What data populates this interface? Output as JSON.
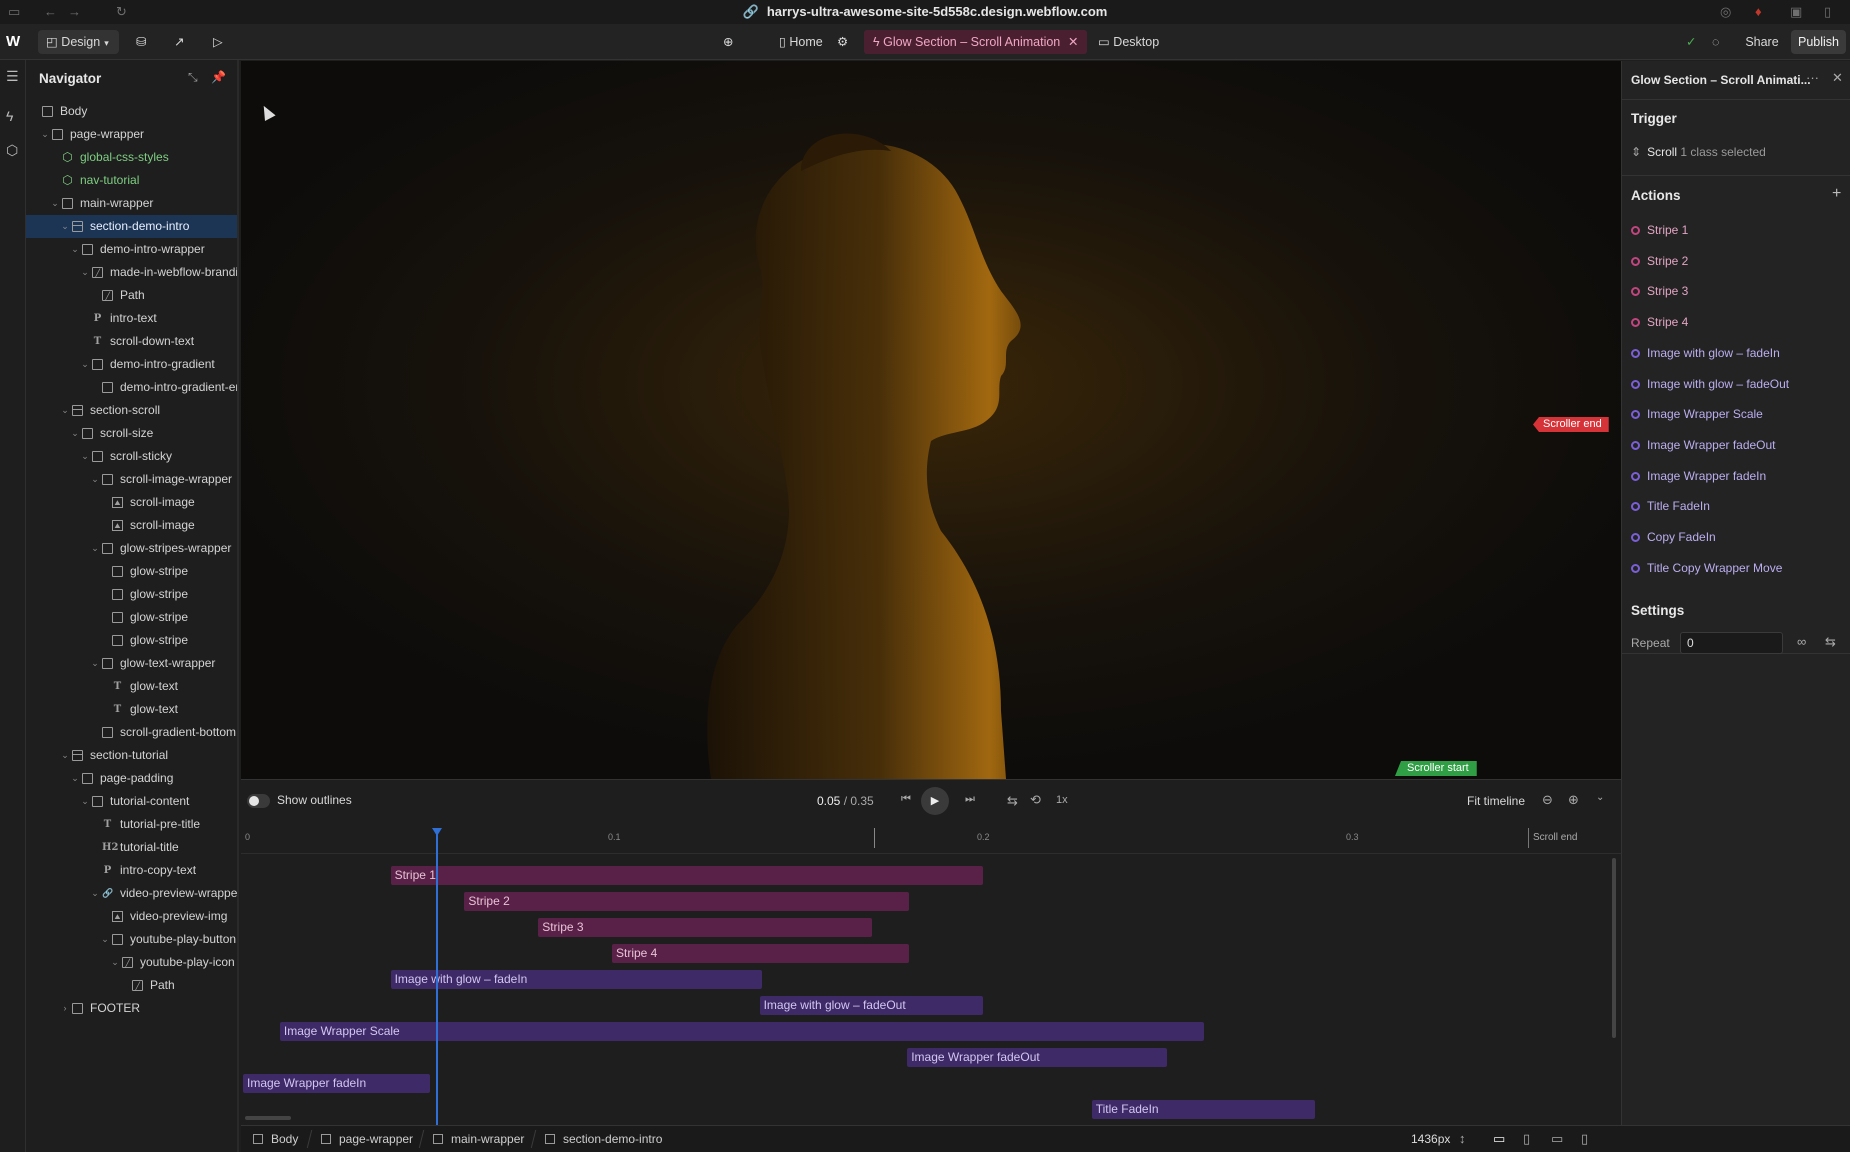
{
  "browser": {
    "url": "harrys-ultra-awesome-site-5d558c.design.webflow.com"
  },
  "toolbar": {
    "mode_label": "Design",
    "page_name": "Home",
    "interaction_name": "Glow Section – Scroll Animation",
    "breakpoint_label": "Desktop",
    "share_label": "Share",
    "publish_label": "Publish"
  },
  "navigator": {
    "title": "Navigator",
    "items": [
      {
        "label": "Body",
        "depth": 0,
        "icon": "box",
        "caret": false
      },
      {
        "label": "page-wrapper",
        "depth": 1,
        "icon": "box",
        "caret": true
      },
      {
        "label": "global-css-styles",
        "depth": 2,
        "icon": "comp",
        "caret": false,
        "green": true
      },
      {
        "label": "nav-tutorial",
        "depth": 2,
        "icon": "comp",
        "caret": false,
        "green": true
      },
      {
        "label": "main-wrapper",
        "depth": 2,
        "icon": "box",
        "caret": true
      },
      {
        "label": "section-demo-intro",
        "depth": 3,
        "icon": "section",
        "caret": true,
        "selected": true
      },
      {
        "label": "demo-intro-wrapper",
        "depth": 4,
        "icon": "box",
        "caret": true
      },
      {
        "label": "made-in-webflow-branding",
        "depth": 5,
        "icon": "svg",
        "caret": true
      },
      {
        "label": "Path",
        "depth": 6,
        "icon": "svg",
        "caret": false
      },
      {
        "label": "intro-text",
        "depth": 5,
        "icon": "P",
        "caret": false
      },
      {
        "label": "scroll-down-text",
        "depth": 5,
        "icon": "T",
        "caret": false
      },
      {
        "label": "demo-intro-gradient",
        "depth": 5,
        "icon": "box",
        "caret": true
      },
      {
        "label": "demo-intro-gradient-end",
        "depth": 6,
        "icon": "box",
        "caret": false
      },
      {
        "label": "section-scroll",
        "depth": 3,
        "icon": "section",
        "caret": true
      },
      {
        "label": "scroll-size",
        "depth": 4,
        "icon": "box",
        "caret": true
      },
      {
        "label": "scroll-sticky",
        "depth": 5,
        "icon": "box",
        "caret": true
      },
      {
        "label": "scroll-image-wrapper",
        "depth": 6,
        "icon": "box",
        "caret": true
      },
      {
        "label": "scroll-image",
        "depth": 7,
        "icon": "img",
        "caret": false
      },
      {
        "label": "scroll-image",
        "depth": 7,
        "icon": "img",
        "caret": false
      },
      {
        "label": "glow-stripes-wrapper",
        "depth": 6,
        "icon": "box",
        "caret": true
      },
      {
        "label": "glow-stripe",
        "depth": 7,
        "icon": "box",
        "caret": false
      },
      {
        "label": "glow-stripe",
        "depth": 7,
        "icon": "box",
        "caret": false
      },
      {
        "label": "glow-stripe",
        "depth": 7,
        "icon": "box",
        "caret": false
      },
      {
        "label": "glow-stripe",
        "depth": 7,
        "icon": "box",
        "caret": false
      },
      {
        "label": "glow-text-wrapper",
        "depth": 6,
        "icon": "box",
        "caret": true
      },
      {
        "label": "glow-text",
        "depth": 7,
        "icon": "T",
        "caret": false
      },
      {
        "label": "glow-text",
        "depth": 7,
        "icon": "T",
        "caret": false
      },
      {
        "label": "scroll-gradient-bottom",
        "depth": 6,
        "icon": "box",
        "caret": false
      },
      {
        "label": "section-tutorial",
        "depth": 3,
        "icon": "section",
        "caret": true
      },
      {
        "label": "page-padding",
        "depth": 4,
        "icon": "box",
        "caret": true
      },
      {
        "label": "tutorial-content",
        "depth": 5,
        "icon": "box",
        "caret": true
      },
      {
        "label": "tutorial-pre-title",
        "depth": 6,
        "icon": "T",
        "caret": false
      },
      {
        "label": "tutorial-title",
        "depth": 6,
        "icon": "H2",
        "caret": false
      },
      {
        "label": "intro-copy-text",
        "depth": 6,
        "icon": "P",
        "caret": false
      },
      {
        "label": "video-preview-wrapper",
        "depth": 6,
        "icon": "link",
        "caret": true
      },
      {
        "label": "video-preview-img",
        "depth": 7,
        "icon": "img",
        "caret": false
      },
      {
        "label": "youtube-play-button",
        "depth": 7,
        "icon": "box",
        "caret": true
      },
      {
        "label": "youtube-play-icon",
        "depth": 8,
        "icon": "svg",
        "caret": true
      },
      {
        "label": "Path",
        "depth": 9,
        "icon": "svg",
        "caret": false
      },
      {
        "label": "FOOTER",
        "depth": 3,
        "icon": "box",
        "caret": "closed"
      }
    ]
  },
  "canvas": {
    "scroller_end_label": "Scroller end",
    "scroller_start_label": "Scroller start"
  },
  "inspector": {
    "title": "Glow Section – Scroll Animati...",
    "trigger_heading": "Trigger",
    "trigger_type": "Scroll",
    "trigger_detail": "1 class selected",
    "actions_heading": "Actions",
    "actions": [
      {
        "label": "Stripe 1",
        "color": "#c2457f"
      },
      {
        "label": "Stripe 2",
        "color": "#c2457f"
      },
      {
        "label": "Stripe 3",
        "color": "#c2457f"
      },
      {
        "label": "Stripe 4",
        "color": "#c2457f"
      },
      {
        "label": "Image with glow – fadeIn",
        "color": "#7b5fd6"
      },
      {
        "label": "Image with glow – fadeOut",
        "color": "#7b5fd6"
      },
      {
        "label": "Image Wrapper Scale",
        "color": "#7b5fd6"
      },
      {
        "label": "Image Wrapper fadeOut",
        "color": "#7b5fd6"
      },
      {
        "label": "Image Wrapper fadeIn",
        "color": "#7b5fd6"
      },
      {
        "label": "Title FadeIn",
        "color": "#7b5fd6"
      },
      {
        "label": "Copy FadeIn",
        "color": "#7b5fd6"
      },
      {
        "label": "Title Copy Wrapper Move",
        "color": "#7b5fd6"
      }
    ],
    "settings_heading": "Settings",
    "repeat_label": "Repeat",
    "repeat_value": "0"
  },
  "timeline": {
    "show_outlines_label": "Show outlines",
    "current_time": "0.05",
    "total_time": "/ 0.35",
    "speed_label": "1x",
    "fit_label": "Fit timeline",
    "scroll_end_label": "Scroll end",
    "ticks": [
      "0",
      "0.1",
      "0.2",
      "0.3"
    ],
    "tracks": [
      {
        "label": "Stripe 1",
        "color": "pink",
        "start": 0.04,
        "end": 0.2
      },
      {
        "label": "Stripe 2",
        "color": "pink",
        "start": 0.06,
        "end": 0.18
      },
      {
        "label": "Stripe 3",
        "color": "pink",
        "start": 0.08,
        "end": 0.17
      },
      {
        "label": "Stripe 4",
        "color": "pink",
        "start": 0.1,
        "end": 0.18
      },
      {
        "label": "Image with glow – fadeIn",
        "color": "purple",
        "start": 0.04,
        "end": 0.14
      },
      {
        "label": "Image with glow – fadeOut",
        "color": "purple",
        "start": 0.14,
        "end": 0.2
      },
      {
        "label": "Image Wrapper Scale",
        "color": "purple",
        "start": 0.01,
        "end": 0.26
      },
      {
        "label": "Image Wrapper fadeOut",
        "color": "purple",
        "start": 0.18,
        "end": 0.25
      },
      {
        "label": "Image Wrapper fadeIn",
        "color": "purple",
        "start": 0.0,
        "end": 0.05
      },
      {
        "label": "Title FadeIn",
        "color": "purple",
        "start": 0.23,
        "end": 0.29
      }
    ]
  },
  "statusbar": {
    "crumbs": [
      "Body",
      "page-wrapper",
      "main-wrapper",
      "section-demo-intro"
    ],
    "width_label": "1436px"
  }
}
